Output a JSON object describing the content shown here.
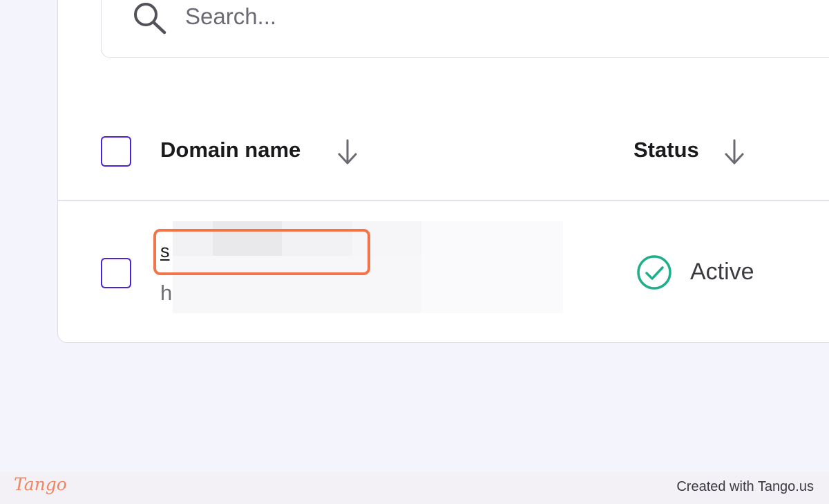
{
  "search": {
    "placeholder": "Search...",
    "icon": "search-icon"
  },
  "table": {
    "columns": [
      {
        "label": "Domain name",
        "sort_icon": "arrow-down-icon"
      },
      {
        "label": "Status",
        "sort_icon": "arrow-down-icon"
      }
    ],
    "rows": [
      {
        "domain": "s",
        "subtext": "h",
        "status": "Active",
        "status_icon": "check-circle-icon"
      }
    ]
  },
  "footer": {
    "logo": "Tango",
    "credit": "Created with Tango.us"
  },
  "colors": {
    "accent": "#4b24d8",
    "highlight": "#f2744a",
    "success": "#1fae8a",
    "page_background": "#f4f4fc"
  }
}
